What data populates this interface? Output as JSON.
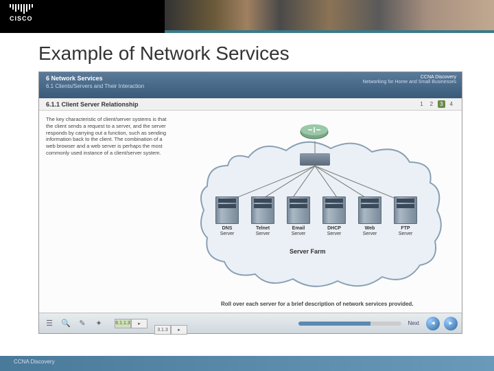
{
  "banner": {
    "logo_text": "CISCO"
  },
  "slide": {
    "title": "Example of Network Services"
  },
  "screenshot": {
    "header": {
      "chapter": "6 Network Services",
      "section": "6.1 Clients/Servers and Their Interaction",
      "course": "CCNA Discovery",
      "course_sub": "Networking for Home and Small Businesses"
    },
    "subhead": {
      "topic": "6.1.1 Client Server Relationship",
      "pages": [
        "1",
        "2",
        "3",
        "4"
      ],
      "active_page_index": 2
    },
    "body_text": "The key characteristic of client/server systems is that the client sends a request to a server, and the server responds by carrying out a function, such as sending information back to the client. The combination of a web browser and a web server is perhaps the most commonly used instance of a client/server system.",
    "servers": [
      {
        "name": "DNS",
        "sub": "Server"
      },
      {
        "name": "Telnet",
        "sub": "Server"
      },
      {
        "name": "Email",
        "sub": "Server"
      },
      {
        "name": "DHCP",
        "sub": "Server"
      },
      {
        "name": "Web",
        "sub": "Server"
      },
      {
        "name": "FTP",
        "sub": "Server"
      }
    ],
    "farm_label": "Server Farm",
    "rollover": "Roll over each server for a brief description of network services provided.",
    "footer": {
      "crumb": "6.1.1.3",
      "crumb2": "3.1.3",
      "next_label": "Next"
    }
  },
  "footer": {
    "text": "CCNA Discovery"
  }
}
